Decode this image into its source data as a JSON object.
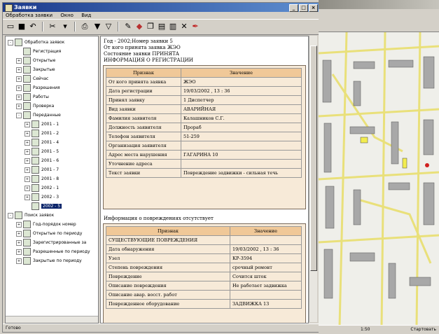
{
  "window": {
    "title": "Заявки",
    "menu": [
      "Обработка заявки",
      "Окно",
      "Вид"
    ]
  },
  "toolbar": {
    "icons": [
      "new-icon",
      "save-icon",
      "undo-icon",
      "delete-icon",
      "dropdown-arrow-icon",
      "print-icon",
      "filter-icon",
      "filter-clear-icon",
      "edit-icon",
      "preview-icon",
      "copy-icon",
      "chart-icon",
      "close-icon",
      "pen-icon"
    ]
  },
  "tree": {
    "items": [
      {
        "label": "Обработка заявок",
        "level": 0,
        "pm": "-"
      },
      {
        "label": "Регистрация",
        "level": 1,
        "pm": ""
      },
      {
        "label": "Открытые",
        "level": 1,
        "pm": "+"
      },
      {
        "label": "Закрытые",
        "level": 1,
        "pm": "+"
      },
      {
        "label": "Сейчас",
        "level": 1,
        "pm": "+"
      },
      {
        "label": "Разрешения",
        "level": 1,
        "pm": "+"
      },
      {
        "label": "Работы",
        "level": 1,
        "pm": "+"
      },
      {
        "label": "Проверка",
        "level": 1,
        "pm": "+"
      },
      {
        "label": "Переданные",
        "level": 1,
        "pm": "-"
      },
      {
        "label": "2001 - 1",
        "level": 2,
        "pm": "+"
      },
      {
        "label": "2001 - 2",
        "level": 2,
        "pm": "+"
      },
      {
        "label": "2001 - 4",
        "level": 2,
        "pm": "+"
      },
      {
        "label": "2001 - 5",
        "level": 2,
        "pm": "+"
      },
      {
        "label": "2001 - 6",
        "level": 2,
        "pm": "+"
      },
      {
        "label": "2001 - 7",
        "level": 2,
        "pm": "+"
      },
      {
        "label": "2001 - 8",
        "level": 2,
        "pm": "+"
      },
      {
        "label": "2002 - 1",
        "level": 2,
        "pm": "+"
      },
      {
        "label": "2002 - 3",
        "level": 2,
        "pm": "+"
      },
      {
        "label": "2002 - 5",
        "level": 2,
        "pm": "",
        "selected": true
      },
      {
        "label": "Поиск заявок",
        "level": 0,
        "pm": "-"
      },
      {
        "label": "Год-порядок номер",
        "level": 1,
        "pm": "+"
      },
      {
        "label": "Открытые по периоду",
        "level": 1,
        "pm": "+"
      },
      {
        "label": "Зарегистрированные за",
        "level": 1,
        "pm": "+"
      },
      {
        "label": "Разрешенные по периоду",
        "level": 1,
        "pm": "+"
      },
      {
        "label": "Закрытые по периоду",
        "level": 1,
        "pm": "+"
      }
    ]
  },
  "doc": {
    "header_lines": [
      "Год - 2002;Номер заявки 5",
      "От кого принята заявка ЖЭО",
      "Состояние заявки ПРИНЯТА",
      "ИНФОРМАЦИЯ О РЕГИСТРАЦИИ"
    ],
    "reg_table": {
      "headers": [
        "Признак",
        "Значение"
      ],
      "rows": [
        [
          "От кого принята заявка",
          "ЖЭО"
        ],
        [
          "Дата регистрации",
          "19/03/2002 , 13 : 36"
        ],
        [
          "Принял заявку",
          "1 Диспетчер"
        ],
        [
          "Вид заявки",
          "АВАРИЙНАЯ"
        ],
        [
          "Фамилия заявителя",
          "Калашников С.Г."
        ],
        [
          "Должность заявителя",
          "Прораб"
        ],
        [
          "Телефон заявителя",
          "51-259"
        ],
        [
          "Организация заявителя",
          ""
        ],
        [
          "Адрес места нарушения",
          "ГАГАРИНА 10"
        ],
        [
          "Уточнение адреса",
          ""
        ],
        [
          "Текст заявки",
          "Повреждение задвижки - сильная течь"
        ]
      ]
    },
    "damage_title": "Информация о повреждениях отсутствует",
    "damage_table": {
      "headers": [
        "Признак",
        "Значение"
      ],
      "rows": [
        [
          "СУЩЕСТВУЮЩИЕ ПОВРЕЖДЕНИЯ",
          ""
        ],
        [
          "Дата обнаружения",
          "19/03/2002 , 13 : 36"
        ],
        [
          "Узел",
          "КР-3594"
        ],
        [
          "Степень повреждения",
          "срочный ремонт"
        ],
        [
          "Повреждение",
          "Сочится шток"
        ],
        [
          "Описание повреждения",
          "Не работает задвижка"
        ],
        [
          "Описание авар. восст. работ",
          ""
        ],
        [
          "Поврежденное оборудование",
          "ЗАДВИЖКА 13"
        ]
      ]
    }
  },
  "status": {
    "left": "Готово"
  },
  "map_status": {
    "mid": "1:50",
    "right": "Стартовать"
  },
  "colors": {
    "title": "#1b3a8c",
    "table_header": "#f0c898",
    "box_bg": "#f7ead8",
    "map_road": "#e9e07a",
    "map_bldg": "#a8a8a8"
  }
}
